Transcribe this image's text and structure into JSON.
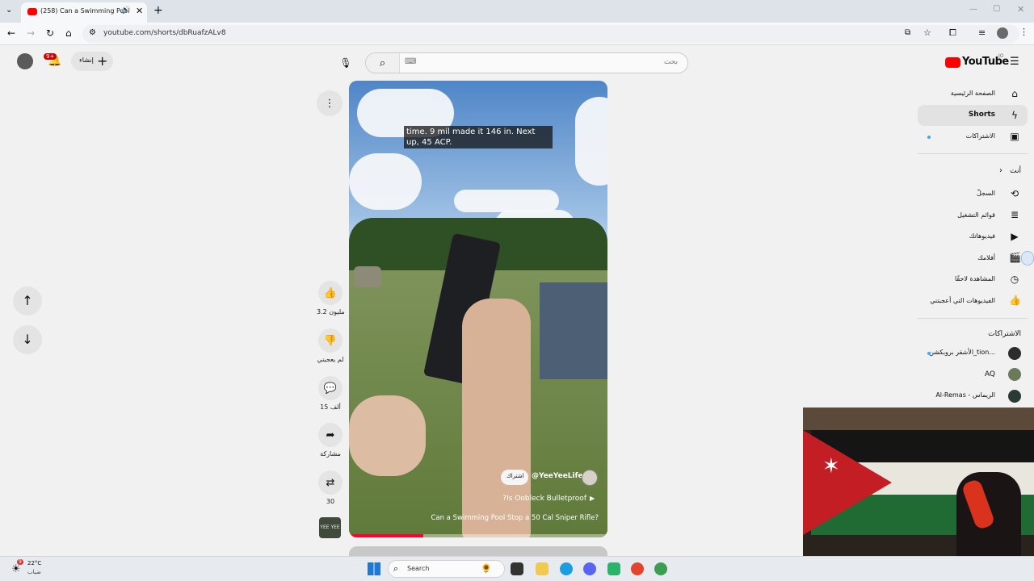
{
  "browser": {
    "tab_title": "(258) Can a Swimming Pool",
    "url": "youtube.com/shorts/dbRuafzALv8"
  },
  "header": {
    "notification_count": "9+",
    "create_label": "إنشاء",
    "search_placeholder": "بحث",
    "logo_text": "YouTube",
    "logo_region": "JO"
  },
  "video": {
    "caption": "time. 9 mil made it 146 in. Next up, 45 ACP.",
    "channel": "@YeeYeeLife",
    "subscribe_label": "اشتراك",
    "linked_video": "Is Oobleck Bulletproof?",
    "title": "Can a Swimming Pool Stop a 50 Cal Sniper Rifle?",
    "channel_avatar_text": "YEE YEE"
  },
  "actions": {
    "likes": "3.2 مليون",
    "dislike_label": "لم يعجبني",
    "comments": "15 ألف",
    "share_label": "مشاركة",
    "remix_count": "30"
  },
  "sidebar": {
    "main_items": [
      {
        "label": "الصفحة الرئيسية",
        "icon": "home-icon"
      },
      {
        "label": "Shorts",
        "icon": "shorts-icon"
      },
      {
        "label": "الاشتراكات",
        "icon": "subscriptions-icon"
      }
    ],
    "you_heading": "أنت",
    "you_items": [
      {
        "label": "السجلّ",
        "icon": "history-icon"
      },
      {
        "label": "قوائم التشغيل",
        "icon": "playlist-icon"
      },
      {
        "label": "فيديوهاتك",
        "icon": "your-videos-icon"
      },
      {
        "label": "أفلامك",
        "icon": "movies-icon"
      },
      {
        "label": "المشاهدة لاحقًا",
        "icon": "watch-later-icon"
      },
      {
        "label": "الفيديوهات التي أعجبتني",
        "icon": "liked-icon"
      }
    ],
    "subs_heading": "الاشتراكات",
    "subs": [
      {
        "label": "الأشقر بروبكشن_tion..."
      },
      {
        "label": "AQ"
      },
      {
        "label": "Al-Remas - الريماس"
      }
    ]
  },
  "taskbar": {
    "weather_temp": "22°C",
    "weather_desc": "ضباب",
    "weather_badge": "9",
    "search_label": "Search"
  }
}
